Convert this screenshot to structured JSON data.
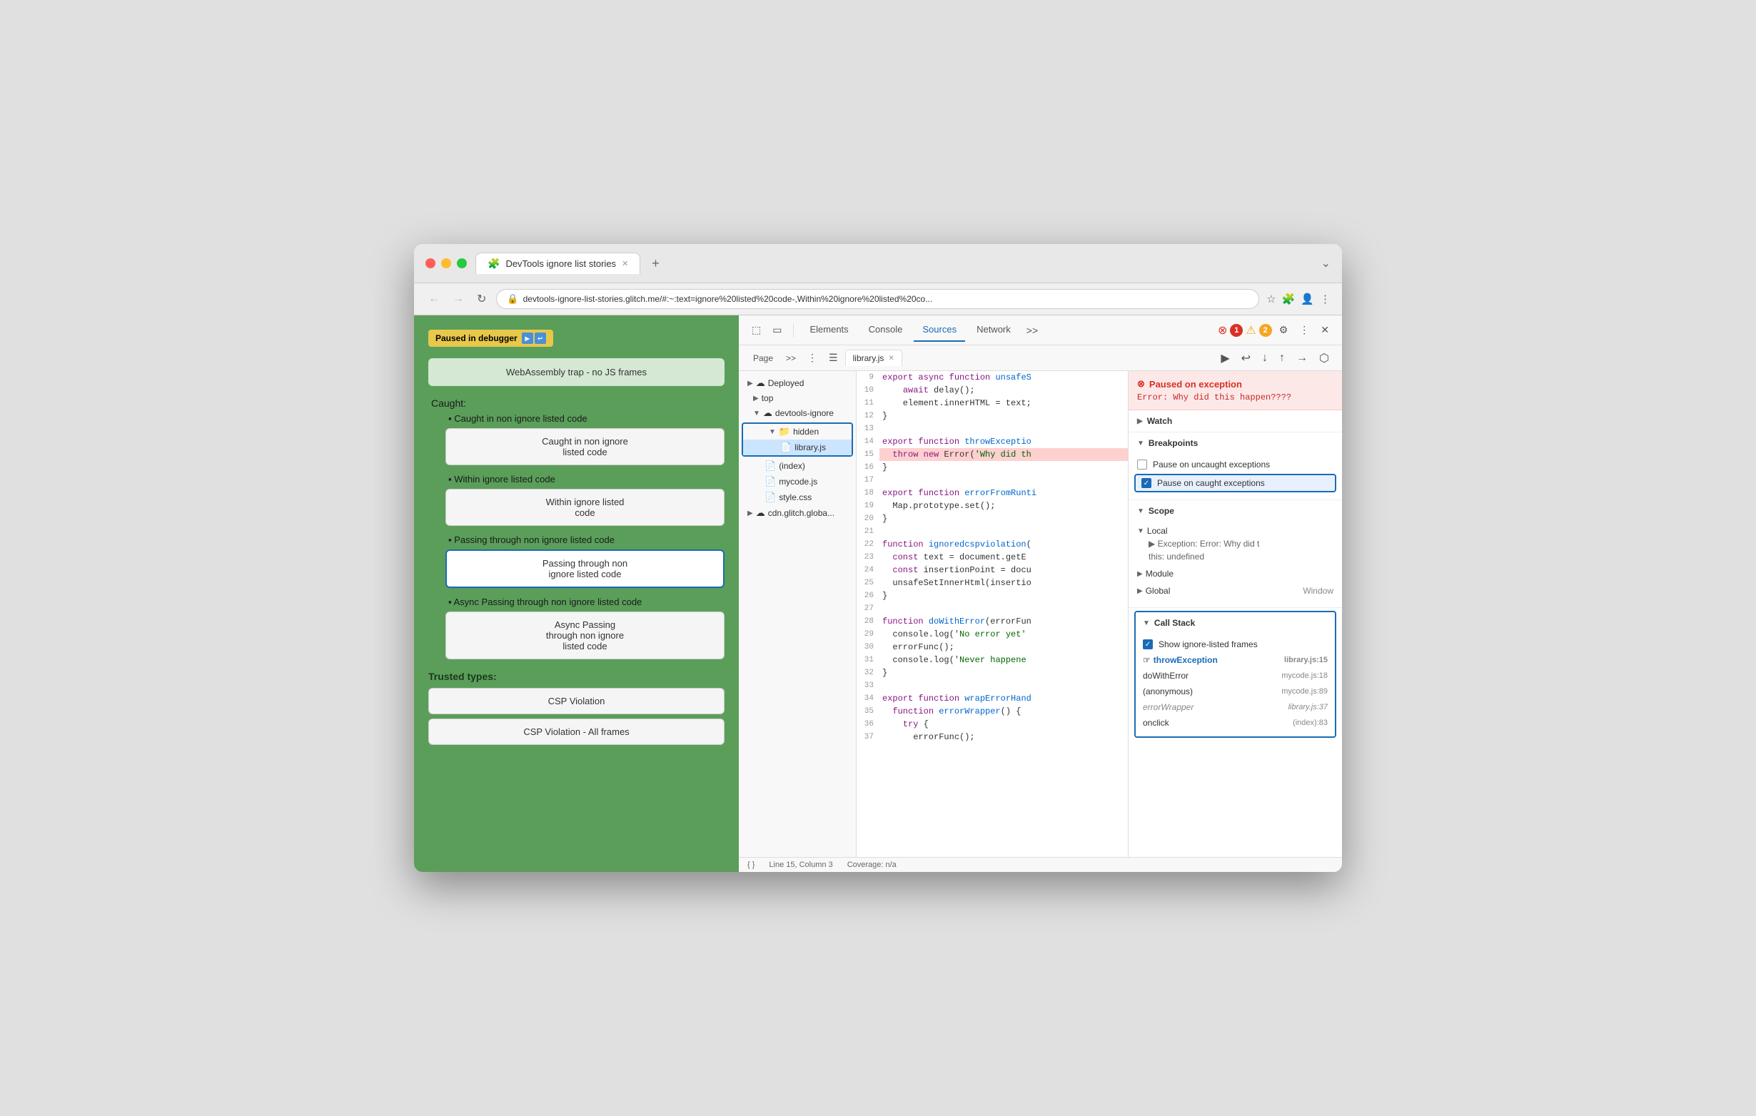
{
  "browser": {
    "title": "DevTools ignore list stories",
    "tab_icon": "🧩",
    "address": "devtools-ignore-list-stories.glitch.me/#:~:text=ignore%20listed%20code-,Within%20ignore%20listed%20co...",
    "nav": {
      "back": "←",
      "forward": "→",
      "reload": "↻"
    }
  },
  "paused_badge": "Paused in debugger",
  "left_sidebar": {
    "webassembly_label": "WebAssembly trap - no JS frames",
    "caught_section": "Caught:",
    "items": [
      {
        "bullet": "▪",
        "label": "Caught in non ignore listed code",
        "btn": "Caught in non ignore listed code",
        "active": false
      },
      {
        "bullet": "▪",
        "label": "Within ignore listed code",
        "btn": "Within ignore listed code",
        "active": false
      },
      {
        "bullet": "▪",
        "label": "Passing through non ignore listed code",
        "btn": "Passing through non ignore listed code",
        "active": true
      },
      {
        "bullet": "▪",
        "label": "Async Passing through non ignore listed code",
        "btn": "Async Passing through non ignore listed code",
        "active": false
      }
    ],
    "trusted_types": "Trusted types:",
    "csp_buttons": [
      "CSP Violation",
      "CSP Violation - All frames"
    ]
  },
  "devtools": {
    "tabs": [
      "Elements",
      "Console",
      "Sources",
      "Network"
    ],
    "active_tab": "Sources",
    "error_count": "1",
    "warning_count": "2",
    "file_tab": "library.js",
    "file_tree": {
      "deployed_label": "Deployed",
      "top_label": "top",
      "devtools_ignore_label": "devtools-ignore",
      "hidden_label": "hidden",
      "library_label": "library.js",
      "index_label": "(index)",
      "mycode_label": "mycode.js",
      "style_label": "style.css",
      "cdn_label": "cdn.glitch.globa..."
    },
    "code_lines": [
      {
        "num": 9,
        "content": "export async function unsafeS",
        "class": ""
      },
      {
        "num": 10,
        "content": "    await delay();",
        "class": ""
      },
      {
        "num": 11,
        "content": "    element.innerHTML = text;",
        "class": ""
      },
      {
        "num": 12,
        "content": "}",
        "class": ""
      },
      {
        "num": 13,
        "content": "",
        "class": ""
      },
      {
        "num": 14,
        "content": "export function throwExceptio",
        "class": ""
      },
      {
        "num": 15,
        "content": "  throw new Error('Why did th",
        "class": "error-line"
      },
      {
        "num": 16,
        "content": "}",
        "class": ""
      },
      {
        "num": 17,
        "content": "",
        "class": ""
      },
      {
        "num": 18,
        "content": "export function errorFromRunti",
        "class": ""
      },
      {
        "num": 19,
        "content": "  Map.prototype.set();",
        "class": ""
      },
      {
        "num": 20,
        "content": "}",
        "class": ""
      },
      {
        "num": 21,
        "content": "",
        "class": ""
      },
      {
        "num": 22,
        "content": "function ignoredcspviolation(",
        "class": ""
      },
      {
        "num": 23,
        "content": "  const text = document.getE",
        "class": ""
      },
      {
        "num": 24,
        "content": "  const insertionPoint = docu",
        "class": ""
      },
      {
        "num": 25,
        "content": "  unsafeSetInnerHtml(insertio",
        "class": ""
      },
      {
        "num": 26,
        "content": "}",
        "class": ""
      },
      {
        "num": 27,
        "content": "",
        "class": ""
      },
      {
        "num": 28,
        "content": "function doWithError(errorFun",
        "class": ""
      },
      {
        "num": 29,
        "content": "  console.log('No error yet'",
        "class": ""
      },
      {
        "num": 30,
        "content": "  errorFunc();",
        "class": ""
      },
      {
        "num": 31,
        "content": "  console.log('Never happene",
        "class": ""
      },
      {
        "num": 32,
        "content": "}",
        "class": ""
      },
      {
        "num": 33,
        "content": "",
        "class": ""
      },
      {
        "num": 34,
        "content": "export function wrapErrorHand",
        "class": ""
      },
      {
        "num": 35,
        "content": "  function errorWrapper() {",
        "class": ""
      },
      {
        "num": 36,
        "content": "    try {",
        "class": ""
      },
      {
        "num": 37,
        "content": "      errorFunc();",
        "class": ""
      }
    ],
    "right_panel": {
      "exception_title": "⊗ Paused on exception",
      "exception_msg": "Error: Why did this happen????",
      "watch_label": "Watch",
      "breakpoints_label": "Breakpoints",
      "pause_uncaught_label": "Pause on uncaught exceptions",
      "pause_caught_label": "Pause on caught exceptions",
      "pause_caught_checked": true,
      "scope_label": "Scope",
      "local_label": "Local",
      "exception_scope": "▶ Exception: Error: Why did t",
      "this_val": "this: undefined",
      "module_label": "Module",
      "global_label": "Global",
      "global_val": "Window",
      "callstack_label": "Call Stack",
      "show_ignore_frames_label": "Show ignore-listed frames",
      "show_ignore_checked": true,
      "callstack_items": [
        {
          "fn": "throwException",
          "loc": "library.js:15",
          "active": true,
          "dimmed": false
        },
        {
          "fn": "doWithError",
          "loc": "mycode.js:18",
          "active": false,
          "dimmed": false
        },
        {
          "fn": "(anonymous)",
          "loc": "mycode.js:89",
          "active": false,
          "dimmed": false
        },
        {
          "fn": "errorWrapper",
          "loc": "library.js:37",
          "active": false,
          "dimmed": true
        },
        {
          "fn": "onclick",
          "loc": "(index):83",
          "active": false,
          "dimmed": false
        }
      ]
    },
    "statusbar": {
      "position": "Line 15, Column 3",
      "coverage": "Coverage: n/a"
    }
  }
}
